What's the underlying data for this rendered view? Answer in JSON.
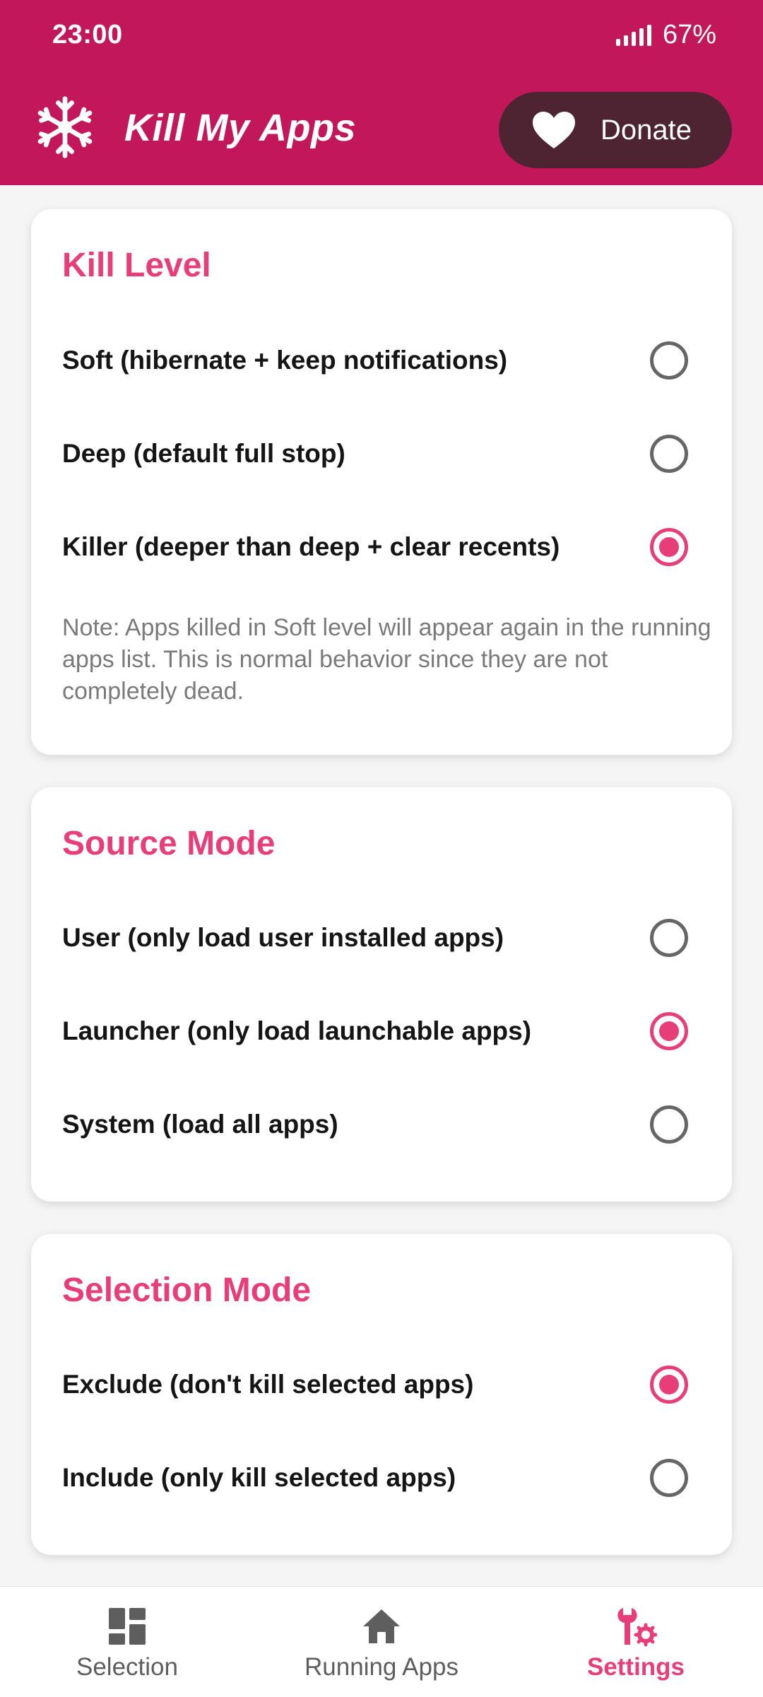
{
  "status_bar": {
    "time": "23:00",
    "battery": "67%"
  },
  "app_bar": {
    "title": "Kill My Apps",
    "donate_label": "Donate",
    "logo_icon": "snowflake-icon",
    "donate_icon": "heart-icon"
  },
  "kill_level": {
    "title": "Kill Level",
    "options": [
      {
        "label": "Soft (hibernate + keep notifications)",
        "selected": false
      },
      {
        "label": "Deep (default full stop)",
        "selected": false
      },
      {
        "label": "Killer (deeper than deep + clear recents)",
        "selected": true
      }
    ],
    "note": "Note: Apps killed in Soft level will appear again in the running apps list. This is normal behavior since they are not completely dead."
  },
  "source_mode": {
    "title": "Source Mode",
    "options": [
      {
        "label": "User (only load user installed apps)",
        "selected": false
      },
      {
        "label": "Launcher (only load launchable apps)",
        "selected": true
      },
      {
        "label": "System (load all apps)",
        "selected": false
      }
    ]
  },
  "selection_mode": {
    "title": "Selection Mode",
    "options": [
      {
        "label": "Exclude (don't kill selected apps)",
        "selected": true
      },
      {
        "label": "Include (only kill selected apps)",
        "selected": false
      }
    ]
  },
  "bottom_nav": {
    "items": [
      {
        "label": "Selection",
        "icon": "dashboard-icon",
        "active": false
      },
      {
        "label": "Running Apps",
        "icon": "home-icon",
        "active": false
      },
      {
        "label": "Settings",
        "icon": "settings-wrench-icon",
        "active": true
      }
    ]
  },
  "colors": {
    "primary": "#c2185b",
    "accent": "#e83e78",
    "donate_bg": "#4e2433"
  }
}
